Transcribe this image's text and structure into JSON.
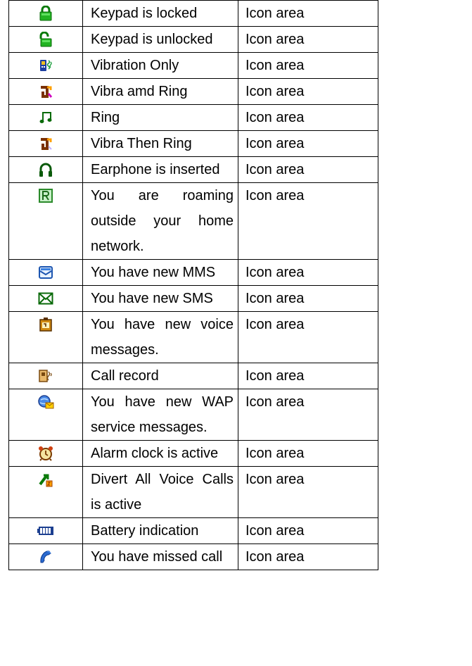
{
  "rows": [
    {
      "icon": "padlock-locked-icon",
      "description": "Keypad is locked",
      "area": "Icon area",
      "lines": 1
    },
    {
      "icon": "padlock-unlocked-icon",
      "description": "Keypad is unlocked",
      "area": "Icon area",
      "lines": 1
    },
    {
      "icon": "vibration-icon",
      "description": "Vibration Only",
      "area": "Icon area",
      "lines": 1
    },
    {
      "icon": "vibra-ring-icon",
      "description": "Vibra amd Ring",
      "area": "Icon area",
      "lines": 1
    },
    {
      "icon": "music-note-icon",
      "description": "Ring",
      "area": "Icon area",
      "lines": 1
    },
    {
      "icon": "vibra-then-ring-icon",
      "description": "Vibra Then Ring",
      "area": "Icon area",
      "lines": 1
    },
    {
      "icon": "headphones-icon",
      "description": "Earphone is inserted",
      "area": "Icon area",
      "lines": 1
    },
    {
      "icon": "roaming-icon",
      "description": "You are roaming outside your home network.",
      "area": "Icon area",
      "lines": 3
    },
    {
      "icon": "mms-icon",
      "description": "You have new MMS",
      "area": "Icon area",
      "lines": 1
    },
    {
      "icon": "sms-envelope-icon",
      "description": "You have new SMS",
      "area": "Icon area",
      "lines": 1
    },
    {
      "icon": "voicemail-icon",
      "description": "You have new voice messages.",
      "area": "Icon area",
      "lines": 2
    },
    {
      "icon": "call-record-icon",
      "description": "Call record",
      "area": "Icon area",
      "lines": 1
    },
    {
      "icon": "wap-message-icon",
      "description": "You have new WAP service messages.",
      "area": "Icon area",
      "lines": 2
    },
    {
      "icon": "alarm-clock-icon",
      "description": "Alarm clock is active",
      "area": "Icon area",
      "lines": 1
    },
    {
      "icon": "divert-calls-icon",
      "description": "Divert All Voice Calls is active",
      "area": "Icon area",
      "lines": 2
    },
    {
      "icon": "battery-icon",
      "description": "Battery indication",
      "area": "Icon area",
      "lines": 1
    },
    {
      "icon": "missed-call-icon",
      "description": "You have missed call",
      "area": "Icon area",
      "lines": 1
    }
  ]
}
